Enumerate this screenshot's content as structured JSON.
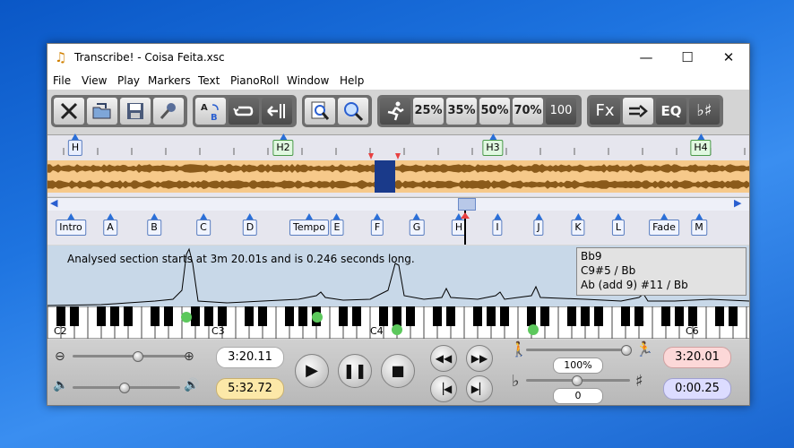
{
  "window": {
    "title": "Transcribe! - Coisa Feita.xsc",
    "min_icon": "minimize-icon",
    "max_icon": "maximize-icon",
    "close_icon": "close-icon"
  },
  "menu": [
    "File",
    "View",
    "Play",
    "Markers",
    "Text",
    "PianoRoll",
    "Window",
    "Help"
  ],
  "toolbar": {
    "speeds": [
      "25%",
      "35%",
      "50%",
      "70%",
      "100"
    ],
    "fx": "Fx",
    "eq": "EQ",
    "transpose": "♭♯",
    "ab": "AB"
  },
  "section_markers": [
    "H",
    "H2",
    "H3",
    "H4"
  ],
  "markers": [
    "Intro",
    "A",
    "B",
    "C",
    "D",
    "Tempo",
    "E",
    "F",
    "G",
    "H",
    "I",
    "J",
    "K",
    "L",
    "Fade",
    "M"
  ],
  "analysis_text": "Analysed section starts at 3m 20.01s and is 0.246 seconds long.",
  "chords": [
    "Bb9",
    "C9#5 / Bb",
    "Ab (add 9) #11 / Bb"
  ],
  "keyboard_labels": [
    "C2",
    "C3",
    "C4",
    "C6"
  ],
  "controls": {
    "position": "3:20.11",
    "length": "5:32.72",
    "speed": "100%",
    "pitch": "0",
    "sel_start": "3:20.01",
    "sel_length": "0:00.25"
  },
  "colors": {
    "accent": "#2a6fd8",
    "wave_bg": "#f6c98a",
    "selection": "#1a3a8a",
    "marker_green": "#5cc85c"
  }
}
